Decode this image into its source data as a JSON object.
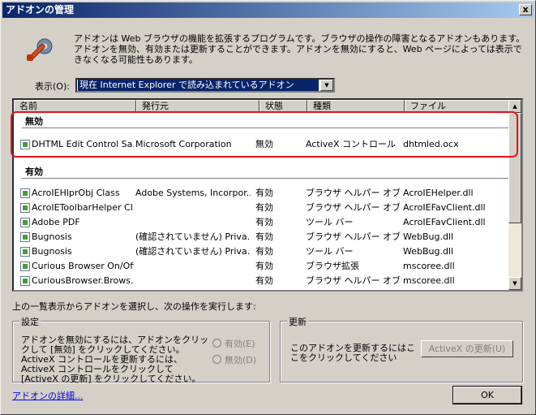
{
  "window": {
    "title": "アドオンの管理",
    "close_glyph": "x"
  },
  "description": "アドオンは Web ブラウザの機能を拡張するプログラムです。ブラウザの操作の障害となるアドオンもあります。アドオンを無効、有効または更新することができます。アドオンを無効にすると、Web ページによっては表示できなくなる可能性もあります。",
  "show": {
    "label": "表示(O):",
    "selected": "現在 Internet Explorer で読み込まれているアドオン"
  },
  "list": {
    "columns": [
      "名前",
      "発行元",
      "状態",
      "種類",
      "ファイル"
    ],
    "groups": [
      {
        "title": "無効",
        "rows": [
          {
            "name": "DHTML Edit Control Sa...",
            "publisher": "Microsoft Corporation",
            "status": "無効",
            "type": "ActiveX コントロール",
            "file": "dhtmled.ocx"
          }
        ]
      },
      {
        "title": "有効",
        "rows": [
          {
            "name": "AcroIEHlprObj Class",
            "publisher": "Adobe Systems, Incorpor...",
            "status": "有効",
            "type": "ブラウザ ヘルパー オブ...",
            "file": "AcroIEHelper.dll"
          },
          {
            "name": "AcroIEToolbarHelper Cl...",
            "publisher": "",
            "status": "有効",
            "type": "ブラウザ ヘルパー オブ...",
            "file": "AcroIEFavClient.dll"
          },
          {
            "name": "Adobe PDF",
            "publisher": "",
            "status": "有効",
            "type": "ツール バー",
            "file": "AcroIEFavClient.dll"
          },
          {
            "name": "Bugnosis",
            "publisher": "(確認されていません) Priva...",
            "status": "有効",
            "type": "ブラウザ ヘルパー オブ...",
            "file": "WebBug.dll"
          },
          {
            "name": "Bugnosis",
            "publisher": "(確認されていません) Priva...",
            "status": "有効",
            "type": "ツール バー",
            "file": "WebBug.dll"
          },
          {
            "name": "Curious Browser On/Off",
            "publisher": "",
            "status": "有効",
            "type": "ブラウザ拡張",
            "file": "mscoree.dll"
          },
          {
            "name": "CuriousBrowser.Brows...",
            "publisher": "",
            "status": "有効",
            "type": "ブラウザ ヘルパー オブ...",
            "file": "mscoree.dll"
          }
        ]
      }
    ]
  },
  "caption": "上の一覧表示からアドオンを選択し、次の操作を実行します:",
  "settings": {
    "title": "設定",
    "text": "アドオンを無効にするには、アドオンをクリックして [無効] をクリックしてください。ActiveX コントロールを更新するには、ActiveX コントロールをクリックして [ActiveX の更新] をクリックしてください。",
    "enable_label": "有効(E)",
    "disable_label": "無効(D)"
  },
  "update": {
    "title": "更新",
    "text": "このアドオンを更新するにはここをクリックしてください",
    "button": "ActiveX の更新(U)"
  },
  "details_link": "アドオンの詳細...",
  "ok_button": "OK"
}
